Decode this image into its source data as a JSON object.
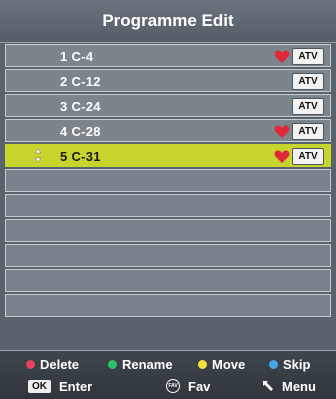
{
  "title": "Programme Edit",
  "channels": [
    {
      "label": "1 C-4",
      "favorite": true,
      "type": "ATV",
      "selected": false
    },
    {
      "label": "2 C-12",
      "favorite": false,
      "type": "ATV",
      "selected": false
    },
    {
      "label": "3 C-24",
      "favorite": false,
      "type": "ATV",
      "selected": false
    },
    {
      "label": "4 C-28",
      "favorite": true,
      "type": "ATV",
      "selected": false
    },
    {
      "label": "5 C-31",
      "favorite": true,
      "type": "ATV",
      "selected": true
    }
  ],
  "footer": {
    "delete": "Delete",
    "rename": "Rename",
    "move": "Move",
    "skip": "Skip",
    "ok_key": "OK",
    "enter": "Enter",
    "fav_key": "FAV",
    "fav": "Fav",
    "menu": "Menu"
  },
  "colors": {
    "delete": "#e8435a",
    "rename": "#2fbf6a",
    "move": "#f0e640",
    "skip": "#4aa3e8",
    "selected_row": "#c8d42e",
    "heart": "#e0283a"
  }
}
